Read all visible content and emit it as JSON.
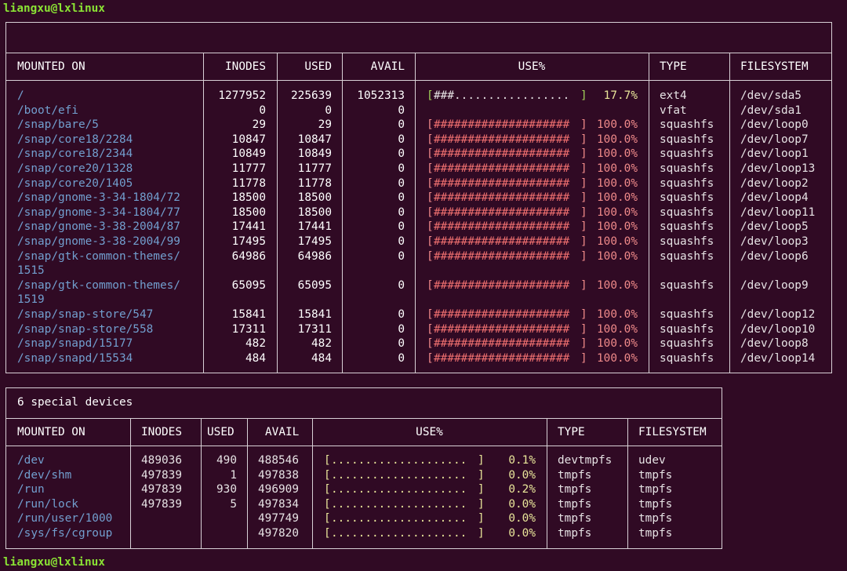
{
  "prompt": {
    "top": "liangxu@lxlinux",
    "bottom": "liangxu@lxlinux"
  },
  "local": {
    "title": "",
    "columns": [
      "MOUNTED ON",
      "INODES",
      "USED",
      "AVAIL",
      "USE%",
      "TYPE",
      "FILESYSTEM"
    ],
    "rows": [
      {
        "mount": "/",
        "inodes": "1277952",
        "used": "225639",
        "avail": "1052313",
        "bar": "###.................",
        "pct": "17.7%",
        "level": "low",
        "type": "ext4",
        "fs": "/dev/sda5"
      },
      {
        "mount": "/boot/efi",
        "inodes": "0",
        "used": "0",
        "avail": "0",
        "bar": "",
        "pct": "",
        "level": "none",
        "type": "vfat",
        "fs": "/dev/sda1"
      },
      {
        "mount": "/snap/bare/5",
        "inodes": "29",
        "used": "29",
        "avail": "0",
        "bar": "####################",
        "pct": "100.0%",
        "level": "full",
        "type": "squashfs",
        "fs": "/dev/loop0"
      },
      {
        "mount": "/snap/core18/2284",
        "inodes": "10847",
        "used": "10847",
        "avail": "0",
        "bar": "####################",
        "pct": "100.0%",
        "level": "full",
        "type": "squashfs",
        "fs": "/dev/loop7"
      },
      {
        "mount": "/snap/core18/2344",
        "inodes": "10849",
        "used": "10849",
        "avail": "0",
        "bar": "####################",
        "pct": "100.0%",
        "level": "full",
        "type": "squashfs",
        "fs": "/dev/loop1"
      },
      {
        "mount": "/snap/core20/1328",
        "inodes": "11777",
        "used": "11777",
        "avail": "0",
        "bar": "####################",
        "pct": "100.0%",
        "level": "full",
        "type": "squashfs",
        "fs": "/dev/loop13"
      },
      {
        "mount": "/snap/core20/1405",
        "inodes": "11778",
        "used": "11778",
        "avail": "0",
        "bar": "####################",
        "pct": "100.0%",
        "level": "full",
        "type": "squashfs",
        "fs": "/dev/loop2"
      },
      {
        "mount": "/snap/gnome-3-34-1804/72",
        "inodes": "18500",
        "used": "18500",
        "avail": "0",
        "bar": "####################",
        "pct": "100.0%",
        "level": "full",
        "type": "squashfs",
        "fs": "/dev/loop4"
      },
      {
        "mount": "/snap/gnome-3-34-1804/77",
        "inodes": "18500",
        "used": "18500",
        "avail": "0",
        "bar": "####################",
        "pct": "100.0%",
        "level": "full",
        "type": "squashfs",
        "fs": "/dev/loop11"
      },
      {
        "mount": "/snap/gnome-3-38-2004/87",
        "inodes": "17441",
        "used": "17441",
        "avail": "0",
        "bar": "####################",
        "pct": "100.0%",
        "level": "full",
        "type": "squashfs",
        "fs": "/dev/loop5"
      },
      {
        "mount": "/snap/gnome-3-38-2004/99",
        "inodes": "17495",
        "used": "17495",
        "avail": "0",
        "bar": "####################",
        "pct": "100.0%",
        "level": "full",
        "type": "squashfs",
        "fs": "/dev/loop3"
      },
      {
        "mount": "/snap/gtk-common-themes/",
        "mount2": "1515",
        "inodes": "64986",
        "used": "64986",
        "avail": "0",
        "bar": "####################",
        "pct": "100.0%",
        "level": "full",
        "type": "squashfs",
        "fs": "/dev/loop6"
      },
      {
        "mount": "/snap/gtk-common-themes/",
        "mount2": "1519",
        "inodes": "65095",
        "used": "65095",
        "avail": "0",
        "bar": "####################",
        "pct": "100.0%",
        "level": "full",
        "type": "squashfs",
        "fs": "/dev/loop9"
      },
      {
        "mount": "/snap/snap-store/547",
        "inodes": "15841",
        "used": "15841",
        "avail": "0",
        "bar": "####################",
        "pct": "100.0%",
        "level": "full",
        "type": "squashfs",
        "fs": "/dev/loop12"
      },
      {
        "mount": "/snap/snap-store/558",
        "inodes": "17311",
        "used": "17311",
        "avail": "0",
        "bar": "####################",
        "pct": "100.0%",
        "level": "full",
        "type": "squashfs",
        "fs": "/dev/loop10"
      },
      {
        "mount": "/snap/snapd/15177",
        "inodes": "482",
        "used": "482",
        "avail": "0",
        "bar": "####################",
        "pct": "100.0%",
        "level": "full",
        "type": "squashfs",
        "fs": "/dev/loop8"
      },
      {
        "mount": "/snap/snapd/15534",
        "inodes": "484",
        "used": "484",
        "avail": "0",
        "bar": "####################",
        "pct": "100.0%",
        "level": "full",
        "type": "squashfs",
        "fs": "/dev/loop14"
      }
    ]
  },
  "special": {
    "title": "6 special devices",
    "columns": [
      "MOUNTED ON",
      "INODES",
      "USED",
      "AVAIL",
      "USE%",
      "TYPE",
      "FILESYSTEM"
    ],
    "rows": [
      {
        "mount": "/dev",
        "inodes": "489036",
        "used": "490",
        "avail": "488546",
        "bar": "....................",
        "pct": "0.1%",
        "level": "low",
        "type": "devtmpfs",
        "fs": "udev"
      },
      {
        "mount": "/dev/shm",
        "inodes": "497839",
        "used": "1",
        "avail": "497838",
        "bar": "....................",
        "pct": "0.0%",
        "level": "low",
        "type": "tmpfs",
        "fs": "tmpfs"
      },
      {
        "mount": "/run",
        "inodes": "497839",
        "used": "930",
        "avail": "496909",
        "bar": "....................",
        "pct": "0.2%",
        "level": "low",
        "type": "tmpfs",
        "fs": "tmpfs"
      },
      {
        "mount": "/run/lock",
        "inodes": "497839",
        "used": "5",
        "avail": "497834",
        "bar": "....................",
        "pct": "0.0%",
        "level": "low",
        "type": "tmpfs",
        "fs": "tmpfs"
      },
      {
        "mount": "/run/user/1000",
        "inodes": "",
        "used": "",
        "avail": "497749",
        "bar": "....................",
        "pct": "0.0%",
        "level": "low",
        "type": "tmpfs",
        "fs": "tmpfs"
      },
      {
        "mount": "/sys/fs/cgroup",
        "inodes": "",
        "used": "",
        "avail": "497820",
        "bar": "....................",
        "pct": "0.0%",
        "level": "low",
        "type": "tmpfs",
        "fs": "tmpfs"
      }
    ]
  }
}
